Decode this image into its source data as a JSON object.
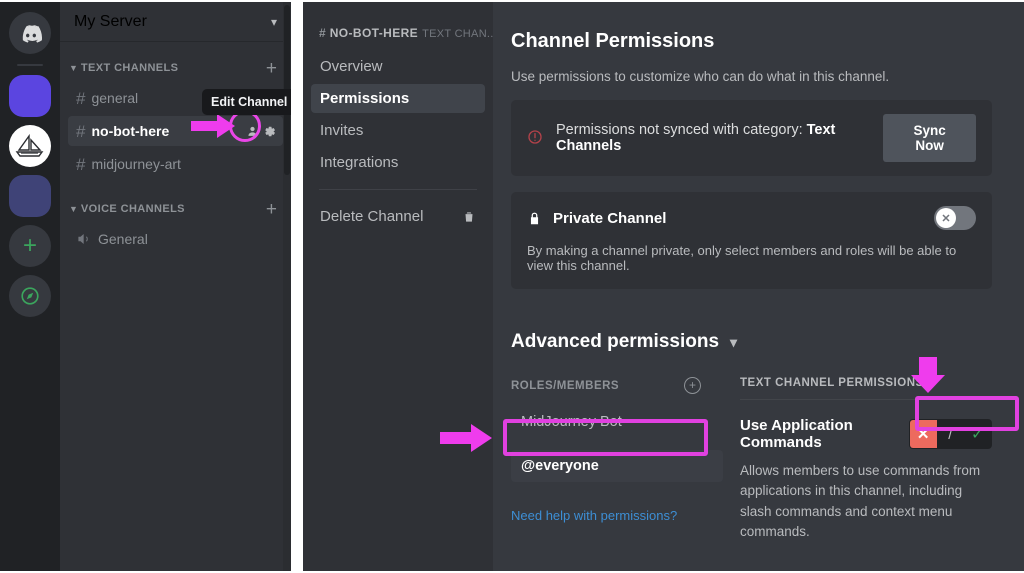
{
  "colors": {
    "accent_magenta": "#e141e0",
    "deny_red": "#ed6a5e",
    "allow_green": "#3ba55d",
    "link_blue": "#3d8ed4",
    "sidebar_bg": "#2f3136",
    "main_bg": "#36393f",
    "rail_bg": "#202225"
  },
  "server_rail": {
    "items": [
      {
        "name": "discord-home-icon",
        "label": "Home"
      },
      {
        "name": "server-icon-purple",
        "label": ""
      },
      {
        "name": "server-icon-midjourney",
        "label": ""
      },
      {
        "name": "server-icon-darkblue",
        "label": ""
      },
      {
        "name": "add-server-icon",
        "label": "+"
      },
      {
        "name": "explore-servers-icon",
        "label": ""
      }
    ]
  },
  "channel_sidebar": {
    "server_name": "My Server",
    "dropdown_icon": "chevron-down-icon",
    "categories": [
      {
        "label": "TEXT CHANNELS",
        "add_icon": "plus-icon",
        "channels": [
          {
            "name": "general",
            "prefix": "#",
            "active": false
          },
          {
            "name": "no-bot-here",
            "prefix": "#",
            "active": true
          },
          {
            "name": "midjourney-art",
            "prefix": "#",
            "active": false
          }
        ]
      },
      {
        "label": "VOICE CHANNELS",
        "add_icon": "plus-icon",
        "channels": [
          {
            "name": "General",
            "prefix": "speaker",
            "active": false
          }
        ]
      }
    ],
    "tooltip": "Edit Channel",
    "channel_actions": [
      "invite-people-icon",
      "edit-channel-gear-icon"
    ]
  },
  "settings_nav": {
    "channel_hash": "#",
    "channel_name": "NO-BOT-HERE",
    "channel_suffix": "TEXT CHAN...",
    "items": [
      {
        "label": "Overview",
        "active": false
      },
      {
        "label": "Permissions",
        "active": true
      },
      {
        "label": "Invites",
        "active": false
      },
      {
        "label": "Integrations",
        "active": false
      }
    ],
    "delete": {
      "label": "Delete Channel",
      "icon": "trash-icon"
    }
  },
  "main": {
    "title": "Channel Permissions",
    "subtitle": "Use permissions to customize who can do what in this channel.",
    "sync_card": {
      "icon": "warning-icon",
      "text_prefix": "Permissions not synced with category: ",
      "category": "Text Channels",
      "button_label": "Sync Now"
    },
    "private_card": {
      "icon": "lock-icon",
      "title": "Private Channel",
      "description": "By making a channel private, only select members and roles will be able to view this channel.",
      "toggle_state": "off",
      "toggle_glyph": "✕"
    },
    "advanced": {
      "title": "Advanced permissions",
      "caret_icon": "chevron-down-icon",
      "roles_header": "ROLES/MEMBERS",
      "add_role_icon": "plus-circle-icon",
      "roles": [
        {
          "label": "MidJourney Bot",
          "selected": false
        },
        {
          "label": "@everyone",
          "selected": true
        }
      ],
      "help_link": "Need help with permissions?",
      "permissions_header": "TEXT CHANNEL PERMISSIONS",
      "permissions": [
        {
          "name": "Use Application Commands",
          "description": "Allows members to use commands from applications in this channel, including slash commands and context menu commands.",
          "state": "deny",
          "deny_glyph": "✕",
          "neutral_glyph": "/",
          "allow_glyph": "✓"
        }
      ]
    }
  },
  "annotations": {
    "gear_circle": "highlight-circle-edit-channel",
    "arrow_to_gear": "magenta-arrow-right",
    "everyone_box": "highlight-box-everyone",
    "arrow_to_everyone": "magenta-arrow-right",
    "deny_box": "highlight-box-permission-toggle",
    "arrow_to_deny": "magenta-arrow-down"
  }
}
